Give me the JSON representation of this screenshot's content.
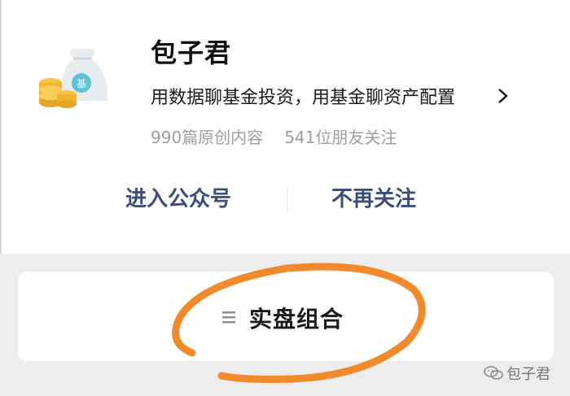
{
  "account": {
    "name": "包子君",
    "description": "用数据聊基金投资，用基金聊资产配置",
    "stats_original": "990篇原创内容",
    "stats_followers": "541位朋友关注",
    "logo_icon": "money-bag-coins-icon"
  },
  "actions": {
    "enter": "进入公众号",
    "unfollow": "不再关注"
  },
  "menu": {
    "label": "实盘组合",
    "icon": "menu-lines-icon"
  },
  "watermark": {
    "text": "包子君",
    "icon": "wechat-icon"
  },
  "colors": {
    "action_text": "#3b4d78",
    "annotation_orange": "#f08a2a",
    "muted_text": "#9f9f9f"
  }
}
